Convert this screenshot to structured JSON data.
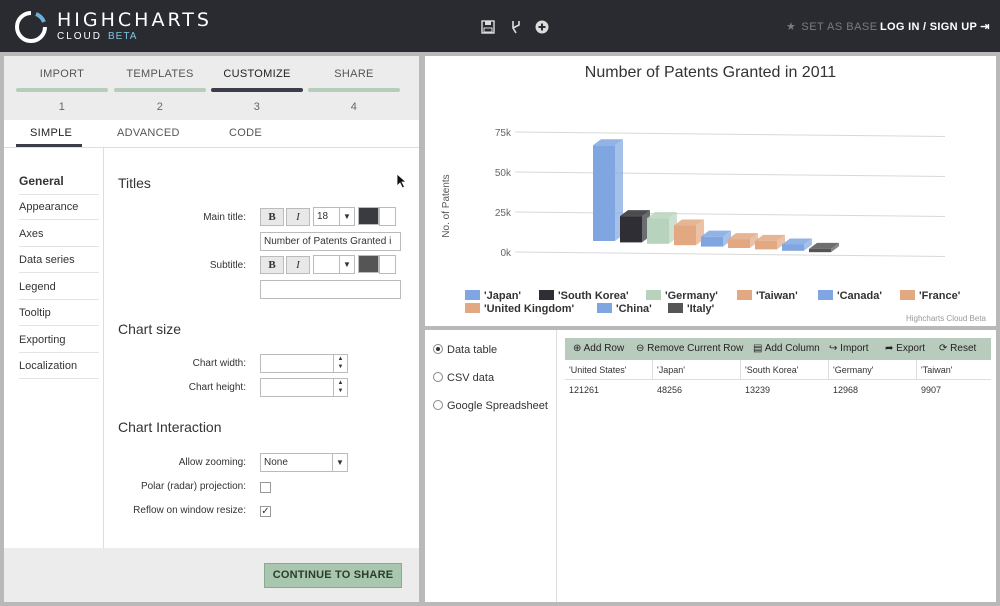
{
  "app": {
    "brand": "HIGHCHARTS",
    "subbrand": "CLOUD",
    "beta": "BETA",
    "set_as_base": "SET AS BASE",
    "login": "LOG IN / SIGN UP"
  },
  "toolbar_icons": [
    "save-icon",
    "fork-icon",
    "add-icon"
  ],
  "steps": [
    {
      "label": "IMPORT",
      "num": "1"
    },
    {
      "label": "TEMPLATES",
      "num": "2"
    },
    {
      "label": "CUSTOMIZE",
      "num": "3"
    },
    {
      "label": "SHARE",
      "num": "4"
    }
  ],
  "subtabs": [
    "SIMPLE",
    "ADVANCED",
    "CODE"
  ],
  "nav": [
    "General",
    "Appearance",
    "Axes",
    "Data series",
    "Legend",
    "Tooltip",
    "Exporting",
    "Localization"
  ],
  "form": {
    "titles_heading": "Titles",
    "main_title_label": "Main title:",
    "bold": "B",
    "italic": "I",
    "font_size": "18",
    "main_title_value": "Number of Patents Granted i",
    "subtitle_label": "Subtitle:",
    "chart_size_heading": "Chart size",
    "chart_width_label": "Chart width:",
    "chart_height_label": "Chart height:",
    "interaction_heading": "Chart Interaction",
    "zoom_label": "Allow zooming:",
    "zoom_value": "None",
    "polar_label": "Polar (radar) projection:",
    "reflow_label": "Reflow on window resize:",
    "polar_checked": false,
    "reflow_checked": true
  },
  "continue_label": "CONTINUE TO SHARE",
  "chart_data": {
    "type": "bar",
    "title": "Number of Patents Granted in 2011",
    "ylabel": "No. of Patents",
    "yticks": [
      "0k",
      "25k",
      "50k",
      "75k"
    ],
    "ylim": [
      0,
      75000
    ],
    "credits": "Highcharts Cloud Beta",
    "categories": [
      "'Japan'",
      "'South Korea'",
      "'Germany'",
      "'Taiwan'",
      "'Canada'",
      "'France'",
      "'United Kingdom'",
      "'China'",
      "'Italy'"
    ],
    "values": [
      48256,
      13239,
      12968,
      9907,
      5000,
      4500,
      4300,
      3200,
      1700
    ],
    "colors": [
      "#7fa6e0",
      "#2e2e34",
      "#b8d3bd",
      "#e2a881",
      "#7fa6e0",
      "#e2a881",
      "#e2a881",
      "#7fa6e0",
      "#555555"
    ]
  },
  "data_formats": [
    "Data table",
    "CSV data",
    "Google Spreadsheet"
  ],
  "grid_toolbar": [
    "Add Row",
    "Remove Current Row",
    "Add Column",
    "Import",
    "Export",
    "Reset"
  ],
  "grid": {
    "headers": [
      "'United States'",
      "'Japan'",
      "'South Korea'",
      "'Germany'",
      "'Taiwan'"
    ],
    "row": [
      "121261",
      "48256",
      "13239",
      "12968",
      "9907"
    ]
  }
}
